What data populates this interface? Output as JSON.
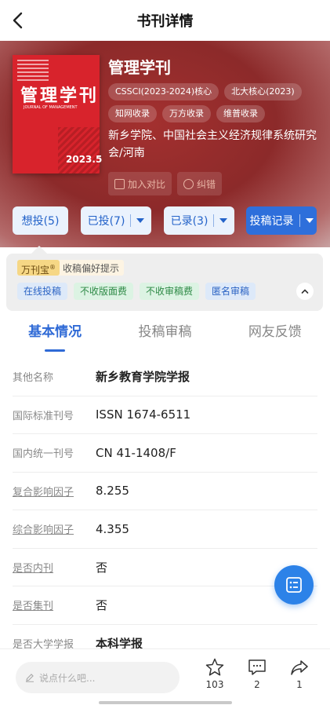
{
  "nav": {
    "title": "书刊详情"
  },
  "journal": {
    "title": "管理学刊",
    "tags": [
      "CSSCI(2023-2024)核心",
      "北大核心(2023)",
      "知网收录",
      "万方收录",
      "维普收录"
    ],
    "publisher": "新乡学院、中国社会主义经济规律系统研究会/河南",
    "cover": {
      "title": "管理学刊",
      "subtitle": "JOURNAL OF MANAGEMENT",
      "issue": "2023.5"
    }
  },
  "actions": {
    "compare": "加入对比",
    "report": "纠错"
  },
  "status": {
    "want": "想投(5)",
    "submitted": "已投(7)",
    "accepted": "已录(3)",
    "record": "投稿记录"
  },
  "preference": {
    "brand": "万刊宝",
    "brand_mark": "®",
    "hint": "收稿偏好提示",
    "tags": [
      {
        "label": "在线投稿",
        "color": "blue"
      },
      {
        "label": "不收版面费",
        "color": "green"
      },
      {
        "label": "不收审稿费",
        "color": "green"
      },
      {
        "label": "匿名审稿",
        "color": "blue"
      }
    ]
  },
  "tabs": [
    "基本情况",
    "投稿审稿",
    "网友反馈"
  ],
  "info": [
    {
      "label": "其他名称",
      "value": "新乡教育学院学报"
    },
    {
      "label": "国际标准刊号",
      "value": "ISSN 1674-6511"
    },
    {
      "label": "国内统一刊号",
      "value": "CN 41-1408/F"
    },
    {
      "label": "复合影响因子",
      "value": "8.255"
    },
    {
      "label": "综合影响因子",
      "value": "4.355"
    },
    {
      "label": "是否内刊",
      "value": "否"
    },
    {
      "label": "是否集刊",
      "value": "否"
    },
    {
      "label": "是否大学学报",
      "value": "本科学报"
    }
  ],
  "bottom": {
    "placeholder": "说点什么吧...",
    "favorites": "103",
    "comments": "2",
    "shares": "1"
  }
}
